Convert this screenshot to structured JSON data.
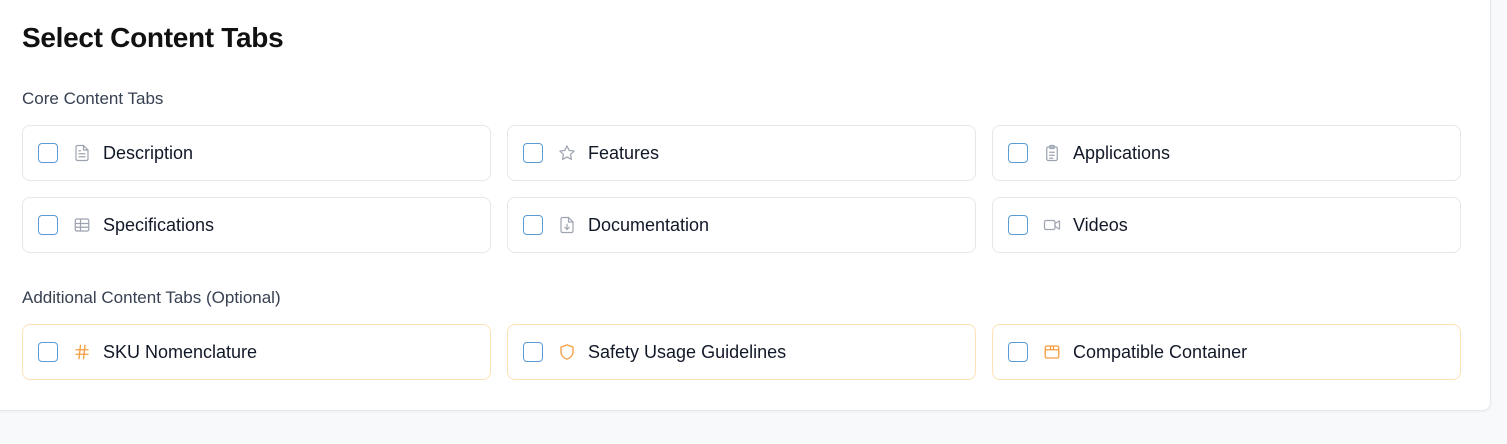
{
  "page": {
    "title": "Select Content Tabs"
  },
  "core": {
    "label": "Core Content Tabs",
    "options": [
      {
        "label": "Description",
        "icon": "document-icon",
        "checked": false
      },
      {
        "label": "Features",
        "icon": "star-icon",
        "checked": false
      },
      {
        "label": "Applications",
        "icon": "clipboard-icon",
        "checked": false
      },
      {
        "label": "Specifications",
        "icon": "table-icon",
        "checked": false
      },
      {
        "label": "Documentation",
        "icon": "file-download-icon",
        "checked": false
      },
      {
        "label": "Videos",
        "icon": "video-icon",
        "checked": false
      }
    ]
  },
  "additional": {
    "label": "Additional Content Tabs (Optional)",
    "options": [
      {
        "label": "SKU Nomenclature",
        "icon": "hash-icon",
        "checked": false
      },
      {
        "label": "Safety Usage Guidelines",
        "icon": "shield-icon",
        "checked": false
      },
      {
        "label": "Compatible Container",
        "icon": "package-icon",
        "checked": false
      }
    ]
  },
  "colors": {
    "checkbox_border": "#5b9bd5",
    "core_icon": "#9ca3af",
    "additional_icon": "#f59e42",
    "additional_border": "#fde2b8"
  }
}
